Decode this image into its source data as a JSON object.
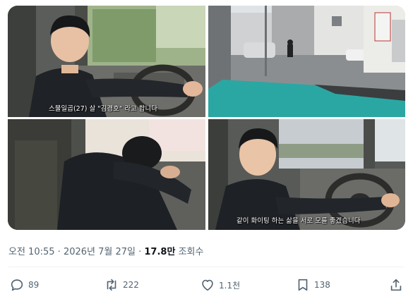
{
  "media": {
    "caption_1": "스물일곱(27) 살 \"김경호\" 라고 합니다",
    "caption_4": "같이 화이팅 하는 삶을 서로 모를 좋겠습니다"
  },
  "tweet_meta": {
    "time": "오전 10:55",
    "separator": " · ",
    "date": "2026년 7월 27일",
    "separator2": " · ",
    "views_count": "17.8만",
    "views_label": " 조회수"
  },
  "actions": {
    "reply_count": "89",
    "retweet_count": "222",
    "like_count": "1.1천",
    "bookmark_count": "138"
  },
  "colors": {
    "text_secondary": "#536471",
    "text_primary": "#0f1419",
    "divider": "#eff3f4"
  }
}
